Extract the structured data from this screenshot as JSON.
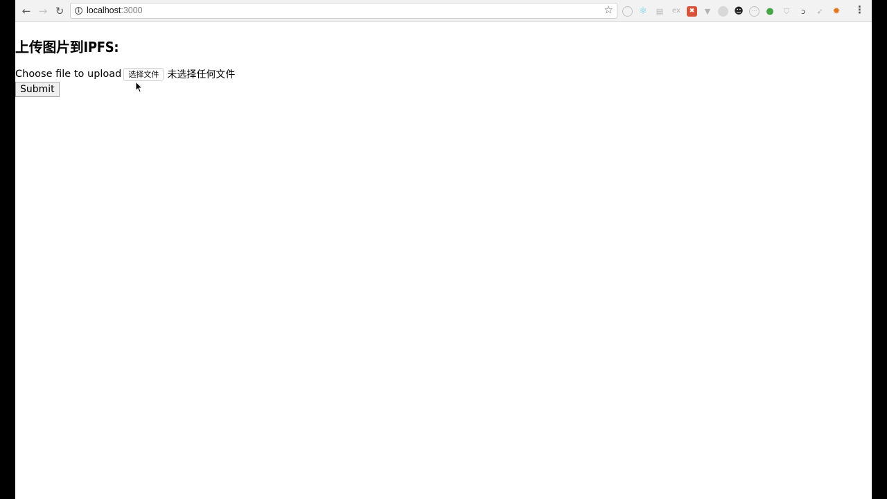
{
  "browser": {
    "url_host": "localhost",
    "url_port": ":3000",
    "nav": {
      "back_icon": "arrow-left-icon",
      "forward_icon": "arrow-right-icon",
      "reload_icon": "reload-icon"
    },
    "extensions": [
      {
        "name": "ext-circle-icon",
        "glyph": "◌"
      },
      {
        "name": "react-devtools-icon",
        "glyph": "⚛"
      },
      {
        "name": "ext-doc-icon",
        "glyph": "▤"
      },
      {
        "name": "ext-ex-icon",
        "glyph": "ex"
      },
      {
        "name": "ext-red-icon",
        "glyph": "✖"
      },
      {
        "name": "vue-devtools-icon",
        "glyph": "▼"
      },
      {
        "name": "ext-gray-circle-icon",
        "glyph": "●"
      },
      {
        "name": "panda-icon",
        "glyph": "☻"
      },
      {
        "name": "ext-dots-icon",
        "glyph": "⋯"
      },
      {
        "name": "wechat-icon",
        "glyph": "●"
      },
      {
        "name": "shield-icon",
        "glyph": "⛉"
      },
      {
        "name": "ext-swirl-icon",
        "glyph": "ↄ"
      },
      {
        "name": "ext-arrow-icon",
        "glyph": "➶"
      },
      {
        "name": "metamask-fox-icon",
        "glyph": "✹"
      }
    ]
  },
  "page": {
    "title": "上传图片到IPFS:",
    "upload_label": "Choose file to upload",
    "file_button": "选择文件",
    "file_status": "未选择任何文件",
    "submit_label": "Submit"
  }
}
